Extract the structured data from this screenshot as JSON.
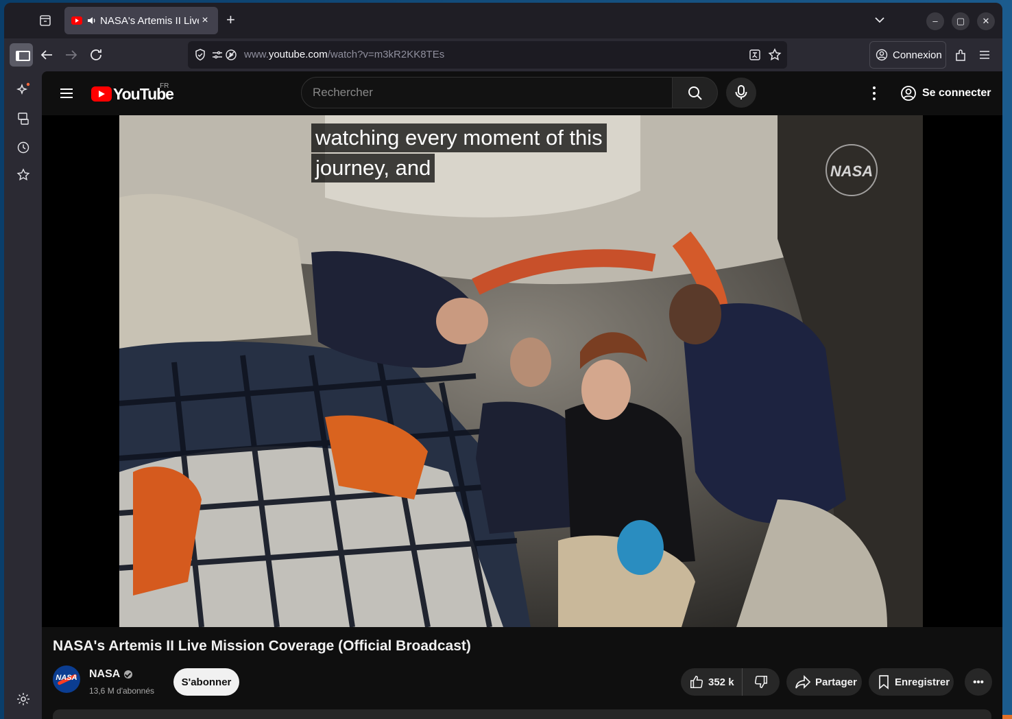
{
  "browser": {
    "tab": {
      "title": "NASA's Artemis II Live",
      "close": "×"
    },
    "new_tab": "+",
    "window_controls": {
      "minimize": "–",
      "maximize": "▢",
      "close": "✕"
    },
    "url": {
      "prefix": "www.",
      "host": "youtube.com",
      "path": "/watch?v=m3kR2KK8TEs"
    },
    "connexion_label": "Connexion",
    "sidebar_icons": [
      "ai-sparkle-icon",
      "synced-tabs-icon",
      "history-icon",
      "bookmarks-icon",
      "settings-icon"
    ]
  },
  "youtube": {
    "logo_word": "YouTube",
    "country_code": "FR",
    "search_placeholder": "Rechercher",
    "signin_label": "Se connecter",
    "caption_lines": [
      "watching every moment of this",
      "journey, and"
    ],
    "watermark": "NASA",
    "video_title": "NASA's Artemis II Live Mission Coverage (Official Broadcast)",
    "channel": {
      "name": "NASA",
      "avatar_text": "NASA",
      "subscribers": "13,6 M d'abonnés"
    },
    "subscribe_label": "S'abonner",
    "likes": "352 k",
    "share_label": "Partager",
    "save_label": "Enregistrer",
    "more_actions": "•••"
  },
  "colors": {
    "youtube_red": "#ff0000",
    "nasa_blue": "#0b3d91",
    "nasa_red": "#fc3d21",
    "firefox_chrome": "#2b2a33"
  }
}
